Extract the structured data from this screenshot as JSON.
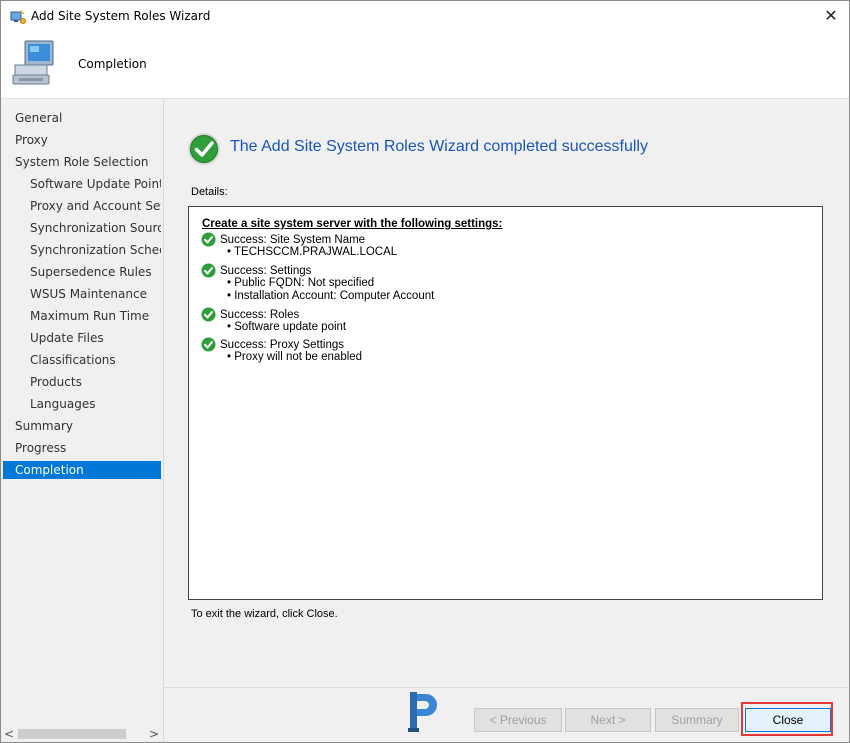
{
  "window": {
    "title": "Add Site System Roles Wizard",
    "close_glyph": "✕"
  },
  "header": {
    "title": "Completion",
    "icon": "computer-icon"
  },
  "sidebar": {
    "items": [
      {
        "label": "General",
        "level": 0
      },
      {
        "label": "Proxy",
        "level": 0
      },
      {
        "label": "System Role Selection",
        "level": 0
      },
      {
        "label": "Software Update Point",
        "level": 1
      },
      {
        "label": "Proxy and Account Settings",
        "level": 1
      },
      {
        "label": "Synchronization Source",
        "level": 1
      },
      {
        "label": "Synchronization Schedule",
        "level": 1
      },
      {
        "label": "Supersedence Rules",
        "level": 1
      },
      {
        "label": "WSUS Maintenance",
        "level": 1
      },
      {
        "label": "Maximum Run Time",
        "level": 1
      },
      {
        "label": "Update Files",
        "level": 1
      },
      {
        "label": "Classifications",
        "level": 1
      },
      {
        "label": "Products",
        "level": 1
      },
      {
        "label": "Languages",
        "level": 1
      },
      {
        "label": "Summary",
        "level": 0
      },
      {
        "label": "Progress",
        "level": 0
      },
      {
        "label": "Completion",
        "level": 0,
        "active": true
      }
    ],
    "scroll_left": "<",
    "scroll_right": ">"
  },
  "main": {
    "success_message": "The Add Site System Roles Wizard completed successfully",
    "details_label": "Details:",
    "details": {
      "heading": "Create a site system server with the following settings:",
      "results": [
        {
          "status": "Success: Site System Name",
          "items": [
            "• TECHSCCM.PRAJWAL.LOCAL"
          ]
        },
        {
          "status": "Success: Settings",
          "items": [
            "• Public FQDN: Not specified",
            "• Installation Account: Computer Account"
          ]
        },
        {
          "status": "Success: Roles",
          "items": [
            "• Software update point"
          ]
        },
        {
          "status": "Success: Proxy Settings",
          "items": [
            "• Proxy will not be enabled"
          ]
        }
      ]
    },
    "exit_note": "To exit the wizard, click Close."
  },
  "footer": {
    "previous_label": "< Previous",
    "next_label": "Next >",
    "summary_label": "Summary",
    "close_label": "Close"
  },
  "colors": {
    "accent": "#0078d7",
    "success_green": "#2e9e3a",
    "title_blue": "#1a56b8",
    "highlight_red": "#e53935"
  }
}
